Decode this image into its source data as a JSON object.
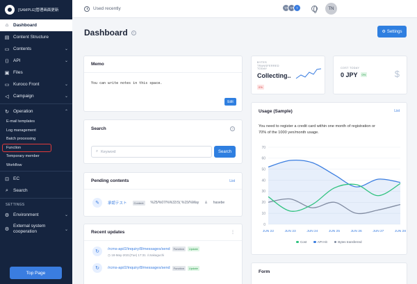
{
  "sidebar": {
    "site_name": "[SAMPLE]管理画面更新",
    "items": [
      {
        "label": "Dashboard",
        "icon": "home-icon",
        "active": true
      },
      {
        "label": "Content Structure",
        "icon": "grid-icon"
      },
      {
        "label": "Contents",
        "icon": "file-icon"
      },
      {
        "label": "API",
        "icon": "code-icon"
      },
      {
        "label": "Files",
        "icon": "folder-icon"
      },
      {
        "label": "Kuroco Front",
        "icon": "monitor-icon"
      },
      {
        "label": "Campaign",
        "icon": "megaphone-icon"
      }
    ],
    "operation": {
      "label": "Operation",
      "children": [
        "E-mail templates",
        "Log management",
        "Batch processing",
        "Function",
        "Temporary member",
        "Workflow"
      ]
    },
    "ec_label": "EC",
    "search_label": "Search",
    "settings_section": "SETTINGS",
    "environment_label": "Environment",
    "external_label_1": "External system",
    "external_label_2": "cooperation",
    "top_page_button": "Top Page"
  },
  "topbar": {
    "recent_label": "Used recently",
    "avatars": [
      {
        "text": "TP",
        "color": "#7b8aa3"
      },
      {
        "text": "TP",
        "color": "#6f80a0"
      },
      {
        "text": "T",
        "color": "#3a7de0"
      }
    ],
    "user_initials": "TN"
  },
  "header": {
    "title": "Dashboard",
    "help_icon": "?",
    "settings_button": "Settings"
  },
  "memo": {
    "title": "Memo",
    "text": "You can write notes in this space.",
    "edit_button": "Edit"
  },
  "search": {
    "title": "Search",
    "placeholder": "Keyword",
    "button": "Search"
  },
  "pending": {
    "title": "Pending contents",
    "list_link": "List",
    "item_title": "承認テスト",
    "item_tag": "Content",
    "item_meta": "%25/%07/%%33:5( %15/%May",
    "item_user": "hasebe"
  },
  "recent_updates": {
    "title": "Recent updates",
    "items": [
      {
        "path": "/rcms-api/2/inquiry/8/messages/send",
        "tag": "Function",
        "status": "Update",
        "meta": "18-May-2021(Tue) 17:31",
        "user": "Sakaguchi"
      },
      {
        "path": "/rcms-api/2/inquiry/8/messages/send",
        "tag": "Function",
        "status": "Update"
      }
    ]
  },
  "stats": {
    "bytes_label_lines": [
      "BYTES",
      "TRANSFERRED",
      "TODAY"
    ],
    "bytes_value": "Collecting..",
    "bytes_pct": "0%",
    "cost_label": "COST TODAY",
    "cost_value": "0 JPY",
    "cost_pct": "0%"
  },
  "usage": {
    "title": "Usage (Sample)",
    "list_link": "List",
    "notice_line1": "You need to register a credit card within one month of registration or",
    "notice_line2": "70% of the 1000 yen/month usage."
  },
  "chart_data": {
    "type": "line",
    "title": "Usage (Sample)",
    "categories": [
      "JUN 22",
      "JUN 23",
      "JUN 24",
      "JUN 25",
      "JUN 26",
      "JUN 27",
      "JUN 28"
    ],
    "ylim": [
      0,
      70
    ],
    "yticks": [
      0,
      10,
      20,
      30,
      40,
      50,
      60,
      70
    ],
    "series": [
      {
        "name": "Cost",
        "color": "#2ec27e",
        "values": [
          25,
          12,
          18,
          33,
          36,
          26,
          37
        ]
      },
      {
        "name": "API Hit",
        "color": "#3a7de0",
        "values": [
          52,
          58,
          56,
          45,
          34,
          41,
          38
        ],
        "fill": true
      },
      {
        "name": "Bytes transferred",
        "color": "#7f8aa0",
        "values": [
          20,
          23,
          15,
          20,
          10,
          13,
          18
        ]
      }
    ],
    "legend_position": "bottom",
    "grid": true
  },
  "form": {
    "title": "Form"
  }
}
